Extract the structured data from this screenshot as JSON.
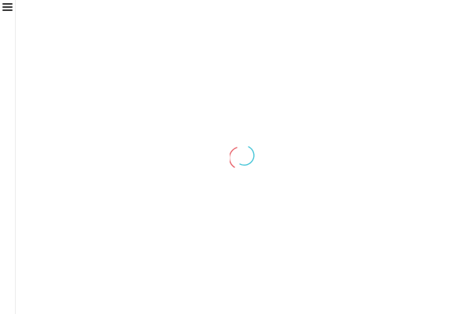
{
  "sidebar": {
    "menu_icon": "hamburger-menu-icon"
  },
  "loader": {
    "icon": "loading-spinner-icon",
    "colors": {
      "outer_arc": "#e8636b",
      "inner_arc": "#48c6d8"
    }
  }
}
